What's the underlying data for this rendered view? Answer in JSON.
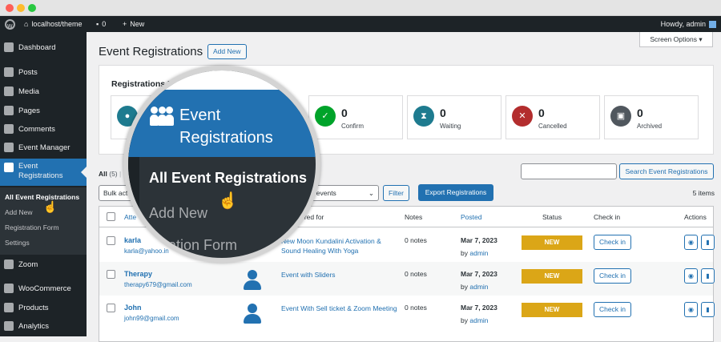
{
  "adminbar": {
    "site": "localhost/theme",
    "comments": "0",
    "new_label": "New",
    "howdy": "Howdy, admin"
  },
  "sidebar": {
    "items": [
      {
        "label": "Dashboard"
      },
      {
        "label": "Posts"
      },
      {
        "label": "Media"
      },
      {
        "label": "Pages"
      },
      {
        "label": "Comments"
      },
      {
        "label": "Event Manager"
      },
      {
        "label": "Event Registrations"
      },
      {
        "label": "Zoom"
      },
      {
        "label": "WooCommerce"
      },
      {
        "label": "Products"
      },
      {
        "label": "Analytics"
      }
    ],
    "submenu": [
      {
        "label": "All Event Registrations"
      },
      {
        "label": "Add New"
      },
      {
        "label": "Registration Form"
      },
      {
        "label": "Settings"
      }
    ]
  },
  "header": {
    "title": "Event Registrations",
    "add_new": "Add New",
    "screen_options": "Screen Options ▾"
  },
  "panel": {
    "title": "Registrations R",
    "cards": [
      {
        "num": "",
        "label": "",
        "color": "#1e7b8f",
        "icon": "user-icon"
      },
      {
        "num": "0",
        "label": "Confirm",
        "color": "#00a32a",
        "icon": "user-check-icon"
      },
      {
        "num": "0",
        "label": "Waiting",
        "color": "#1e7b8f",
        "icon": "hourglass-icon"
      },
      {
        "num": "0",
        "label": "Cancelled",
        "color": "#b32d2e",
        "icon": "user-x-icon"
      },
      {
        "num": "0",
        "label": "Archived",
        "color": "#50575e",
        "icon": "archive-icon"
      }
    ]
  },
  "filters": {
    "all": "All",
    "all_count": "(5)",
    "sep": "|",
    "search_button": "Search Event Registrations",
    "bulk": "Bulk act",
    "dates": "s for all events",
    "filter": "Filter",
    "export": "Export Registrations",
    "items": "5 items"
  },
  "table": {
    "headers": {
      "attendee": "Atte",
      "registered": "Registered for",
      "notes": "Notes",
      "posted": "Posted",
      "status": "Status",
      "checkin": "Check in",
      "actions": "Actions"
    },
    "rows": [
      {
        "name": "karla",
        "email": "karla@yahoo.in",
        "event": "New Moon Kundalini Activation & Sound Healing With Yoga",
        "notes": "0 notes",
        "date": "Mar 7, 2023",
        "by": "by",
        "by_user": "admin",
        "status": "NEW",
        "checkin": "Check in"
      },
      {
        "name": "Therapy",
        "email": "therapy679@gmail.com",
        "event": "Event with Sliders",
        "notes": "0 notes",
        "date": "Mar 7, 2023",
        "by": "by",
        "by_user": "admin",
        "status": "NEW",
        "checkin": "Check in"
      },
      {
        "name": "John",
        "email": "john99@gmail.com",
        "event": "Event With Sell ticket & Zoom Meeting",
        "notes": "0 notes",
        "date": "Mar 7, 2023",
        "by": "by",
        "by_user": "admin",
        "status": "NEW",
        "checkin": "Check in"
      }
    ]
  },
  "magnifier": {
    "title": "Event Registrations",
    "sub1": "All Event Registrations",
    "sub2": "Add New",
    "sub3": "istration Form"
  }
}
